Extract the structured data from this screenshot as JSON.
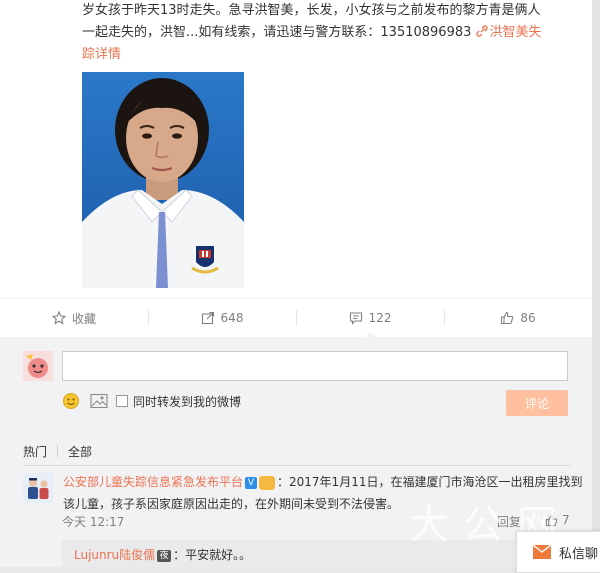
{
  "post": {
    "line1": "岁女孩于昨天13时走失。急寻洪智美，长发，小女孩与之前发布的黎方青是俩人",
    "line2a": "一起走失的，洪智...如有线索，请迅速与警方联系：13510896983 ",
    "link_icon": "link-icon",
    "link_text": "洪智美失",
    "line3": "踪详情"
  },
  "actions": {
    "favorite_label": "收藏",
    "share_count": "648",
    "comment_count": "122",
    "like_count": "86"
  },
  "composer": {
    "sync_label": "同时转发到我的微博",
    "submit_label": "评论"
  },
  "tabs": {
    "hot": "热门",
    "all": "全部"
  },
  "comment": {
    "user": "公安部儿童失踪信息紧急发布平台",
    "verify_mark": "V",
    "text_line1": "：2017年1月11日，在福建厦门市海沧区一出租房里找到",
    "text_line2": "该儿童，孩子系因家庭原因出走的，在外期间未受到不法侵害。",
    "time": "今天 12:17",
    "reply_label": "回复",
    "like_count": "7"
  },
  "sub_reply": {
    "user": "Lujunru陆俊儒",
    "badge": "夜",
    "text": "：平安就好。。"
  },
  "message_tab": {
    "label": "私信聊"
  },
  "watermark": "大公网",
  "colors": {
    "link": "#eb7350",
    "submit_disabled": "#ffc09f",
    "comment_bg": "#f2f2f5"
  }
}
